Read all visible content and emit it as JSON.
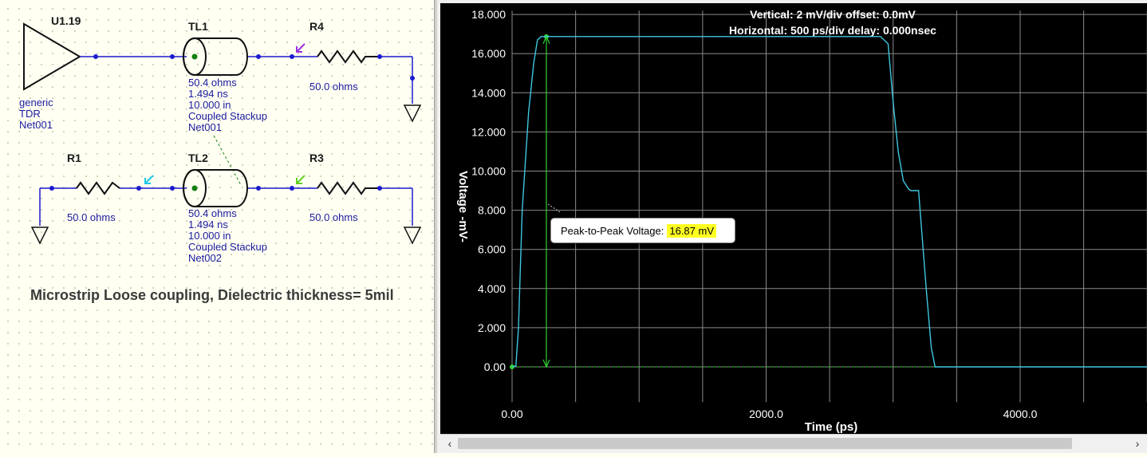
{
  "schematic": {
    "components": {
      "u1": {
        "ref": "U1.19",
        "line1": "generic",
        "line2": "TDR",
        "line3": "Net001"
      },
      "tl1": {
        "ref": "TL1",
        "line1": "50.4 ohms",
        "line2": "1.494 ns",
        "line3": "10.000 in",
        "line4": "Coupled Stackup",
        "line5": "Net001"
      },
      "tl2": {
        "ref": "TL2",
        "line1": "50.4 ohms",
        "line2": "1.494 ns",
        "line3": "10.000 in",
        "line4": "Coupled Stackup",
        "line5": "Net002"
      },
      "r4": {
        "ref": "R4",
        "value": "50.0 ohms"
      },
      "r1": {
        "ref": "R1",
        "value": "50.0 ohms"
      },
      "r3": {
        "ref": "R3",
        "value": "50.0 ohms"
      }
    },
    "caption": "Microstrip Loose coupling, Dielectric thickness= 5mil",
    "colors": {
      "wire": "#1a1ad0",
      "node": "#1a1ad0",
      "tl_node": "#108010",
      "probe_r4": "#9a30e0",
      "probe_r1": "#20c8e8",
      "probe_r3": "#60d020"
    }
  },
  "scope": {
    "header": {
      "vertical": "Vertical: 2 mV/div  offset: 0.0mV",
      "horizontal": "Horizontal: 500 ps/div  delay: 0.000nsec"
    },
    "tooltip": {
      "label": "Peak-to-Peak Voltage:",
      "value": "16.87 mV"
    }
  },
  "chart_data": {
    "type": "line",
    "xlabel": "Time  (ps)",
    "ylabel": "Voltage  -mV-",
    "xlim": [
      0,
      5000
    ],
    "ylim": [
      -1.8,
      18.2
    ],
    "x_ticks": [
      {
        "v": 0,
        "label": "0.00"
      },
      {
        "v": 2000,
        "label": "2000.0"
      },
      {
        "v": 4000,
        "label": "4000.0"
      }
    ],
    "y_ticks": [
      {
        "v": 0,
        "label": "0.00"
      },
      {
        "v": 2,
        "label": "2.000"
      },
      {
        "v": 4,
        "label": "4.000"
      },
      {
        "v": 6,
        "label": "6.000"
      },
      {
        "v": 8,
        "label": "8.000"
      },
      {
        "v": 10,
        "label": "10.000"
      },
      {
        "v": 12,
        "label": "12.000"
      },
      {
        "v": 14,
        "label": "14.000"
      },
      {
        "v": 16,
        "label": "16.000"
      },
      {
        "v": 18,
        "label": "18.000"
      }
    ],
    "grid": true,
    "series": [
      {
        "color": "#3ec8e0",
        "x": [
          0,
          30,
          50,
          80,
          130,
          170,
          200,
          230,
          1500,
          2900,
          2960,
          3000,
          3040,
          3080,
          3120,
          3140,
          3200,
          3260,
          3300,
          3330,
          4000,
          5000
        ],
        "y": [
          0,
          0.05,
          2,
          8,
          13,
          15.5,
          16.7,
          16.87,
          16.87,
          16.87,
          16.5,
          13.5,
          11,
          9.5,
          9.1,
          9.0,
          9.0,
          4,
          1,
          0,
          0,
          0
        ]
      }
    ],
    "measurement": {
      "type": "peak-to-peak",
      "x": 270,
      "y_low": 0,
      "y_high": 16.87,
      "color": "#30d030"
    },
    "baseline_color": "#30d030"
  }
}
